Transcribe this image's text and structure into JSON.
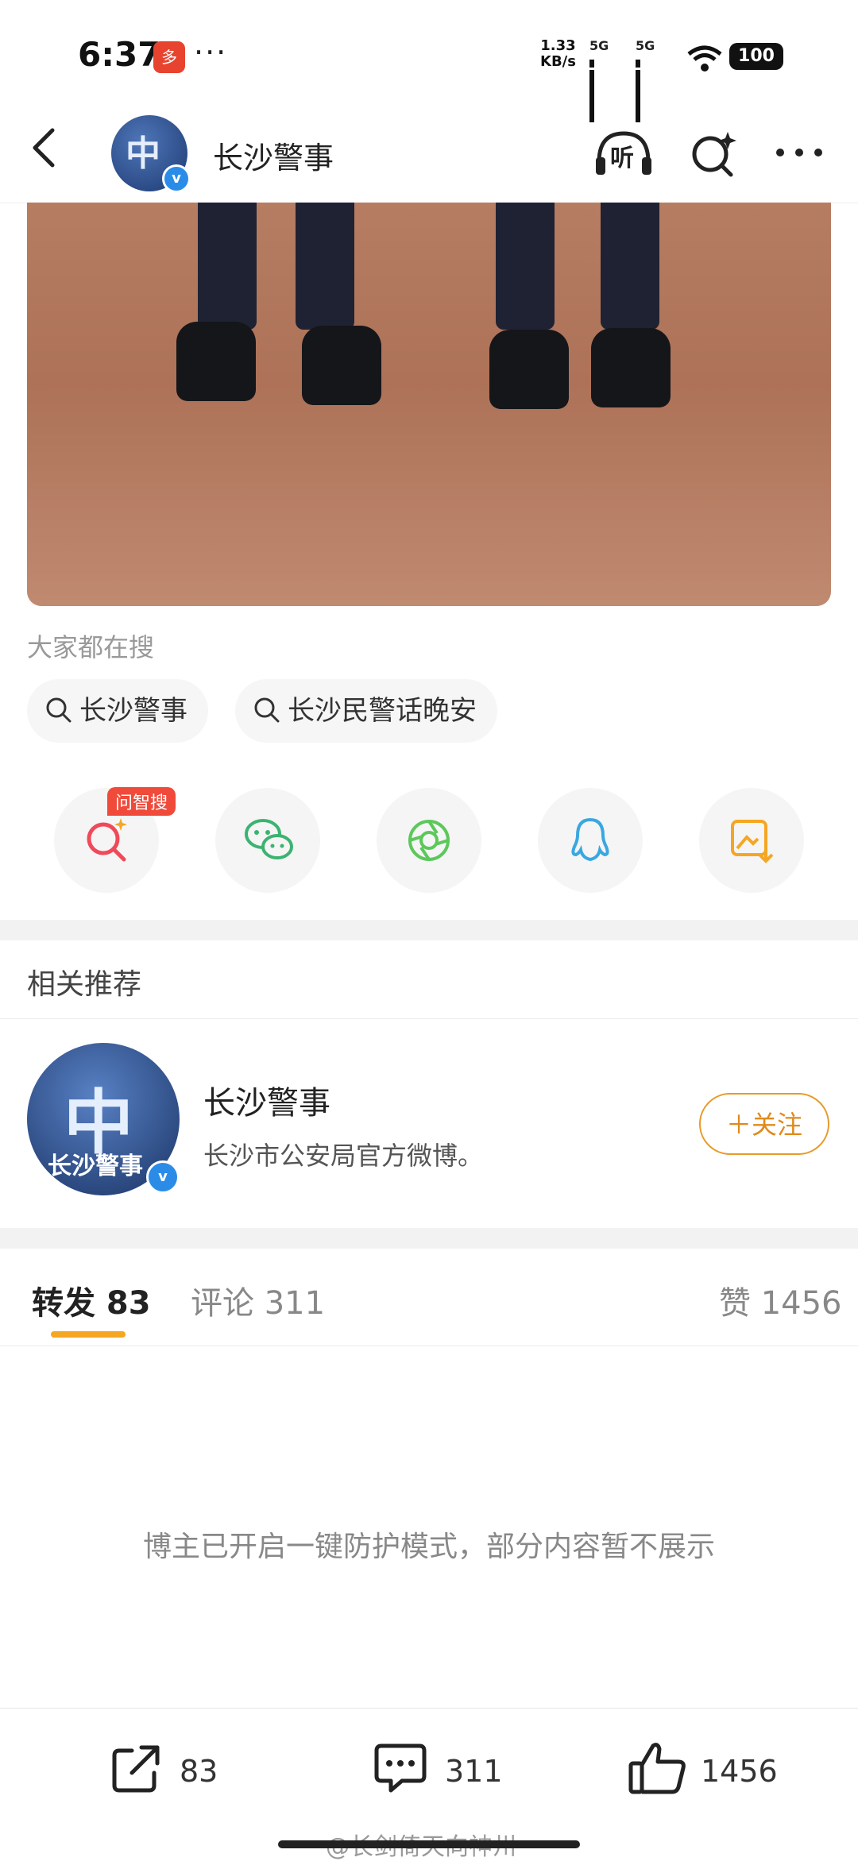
{
  "status_bar": {
    "time": "6:37",
    "app_badge": "拼多多",
    "more": "···",
    "net_speed_value": "1.33",
    "net_speed_unit": "KB/s",
    "network_1": "5G",
    "network_2": "5G",
    "battery": "100"
  },
  "header": {
    "title": "长沙警事",
    "listen_label": "听"
  },
  "search_suggest": {
    "label": "大家都在搜",
    "chips": [
      "长沙警事",
      "长沙民警话晚安"
    ]
  },
  "share": {
    "tag": "问智搜",
    "icons": [
      "ai-search-icon",
      "wechat-icon",
      "moments-icon",
      "qq-icon",
      "save-image-icon"
    ]
  },
  "recommend": {
    "title": "相关推荐",
    "name": "长沙警事",
    "desc": "长沙市公安局官方微博。",
    "follow": "＋关注"
  },
  "tabs": {
    "repost": "转发 83",
    "comment": "评论 311",
    "like": "赞 1456"
  },
  "notice": "博主已开启一键防护模式，部分内容暂不展示",
  "bottom_bar": {
    "repost_count": "83",
    "comment_count": "311",
    "like_count": "1456"
  },
  "watermark": "@长剑倚天向神州",
  "colors": {
    "accent": "#f5a623",
    "follow": "#e08a1a",
    "verify": "#2b8ce8",
    "tag": "#f04a3a"
  }
}
